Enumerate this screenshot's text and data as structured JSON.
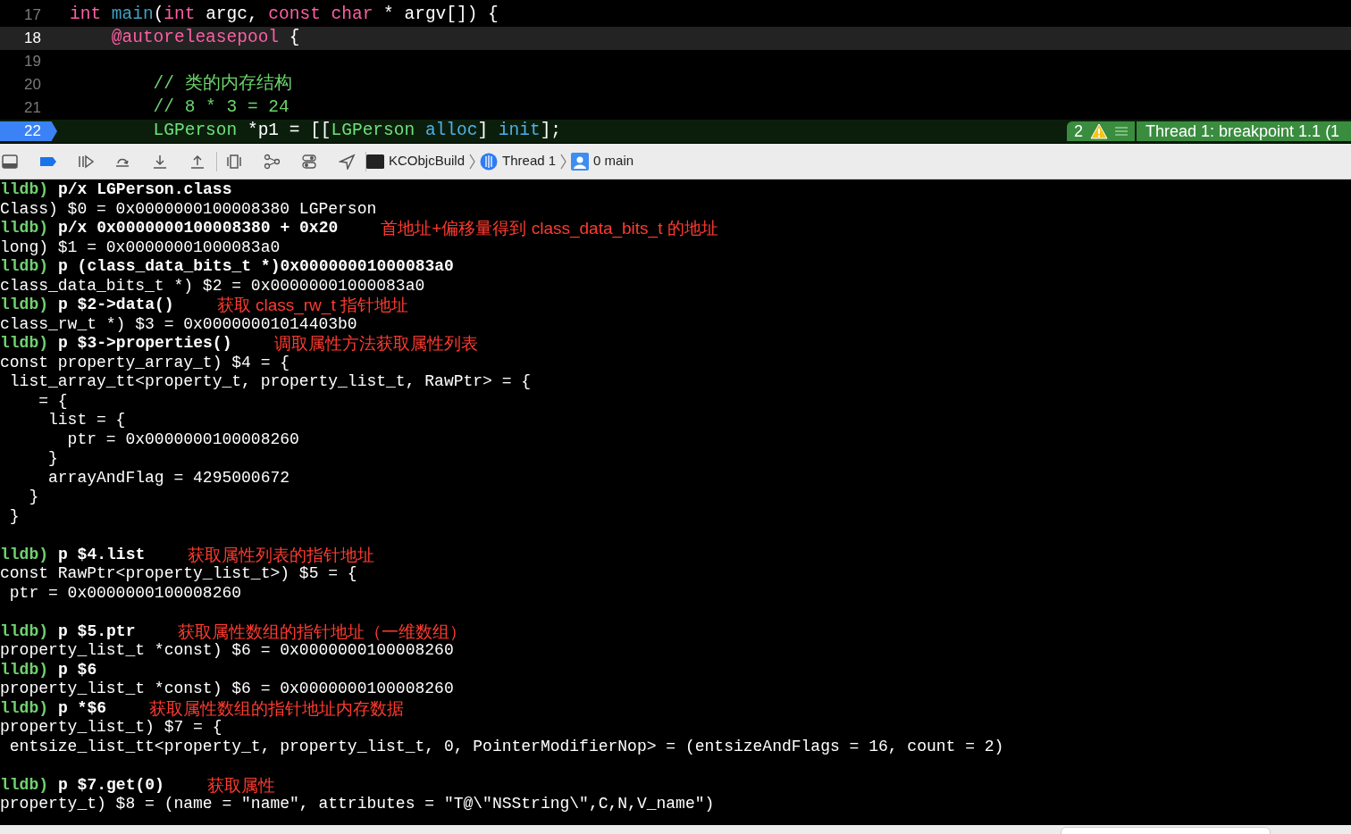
{
  "editor": {
    "lines": [
      {
        "number": "17",
        "highlighted": false,
        "breakpoint": false,
        "tokens": [
          {
            "kind": "keyword",
            "text": "int"
          },
          {
            "kind": "function",
            "text": " main"
          },
          {
            "kind": "plain",
            "text": "("
          },
          {
            "kind": "keyword",
            "text": "int"
          },
          {
            "kind": "plain",
            "text": " argc, "
          },
          {
            "kind": "keyword",
            "text": "const char"
          },
          {
            "kind": "plain",
            "text": " * argv[]) {"
          }
        ]
      },
      {
        "number": "18",
        "highlighted": true,
        "breakpoint": false,
        "tokens": [
          {
            "kind": "keyword",
            "text": "    @autoreleasepool"
          },
          {
            "kind": "plain",
            "text": " {"
          }
        ]
      },
      {
        "number": "19",
        "highlighted": false,
        "breakpoint": false
      },
      {
        "number": "20",
        "highlighted": false,
        "breakpoint": false,
        "tokens": [
          {
            "kind": "comment",
            "text": "        // 类的内存结构"
          }
        ]
      },
      {
        "number": "21",
        "highlighted": false,
        "breakpoint": false,
        "tokens": [
          {
            "kind": "comment",
            "text": "        // 8 * 3 = 24"
          }
        ]
      },
      {
        "number": "22",
        "highlighted": false,
        "breakpoint": true,
        "tokens": [
          {
            "kind": "type",
            "text": "        LGPerson"
          },
          {
            "kind": "plain",
            "text": " *p1 = [["
          },
          {
            "kind": "type",
            "text": "LGPerson"
          },
          {
            "kind": "method",
            "text": " alloc"
          },
          {
            "kind": "plain",
            "text": "] "
          },
          {
            "kind": "method",
            "text": "init"
          },
          {
            "kind": "plain",
            "text": "];"
          }
        ]
      }
    ],
    "badge": {
      "count": "2",
      "message": "Thread 1: breakpoint 1.1 (1"
    }
  },
  "debug_bar": {
    "breadcrumbs": [
      {
        "kind": "target",
        "label": "KCObjcBuild"
      },
      {
        "kind": "thread",
        "label": "Thread 1"
      },
      {
        "kind": "frame",
        "label": "0 main"
      }
    ]
  },
  "console": {
    "lines": [
      {
        "kind": "prompt",
        "prompt": "lldb)",
        "command": "p/x LGPerson.class"
      },
      {
        "kind": "output",
        "text": "Class) $0 = 0x0000000100008380 LGPerson"
      },
      {
        "kind": "prompt",
        "prompt": "lldb)",
        "command": "p/x 0x0000000100008380 + 0x20",
        "note": "首地址+偏移量得到 class_data_bits_t 的地址"
      },
      {
        "kind": "output",
        "text": "long) $1 = 0x00000001000083a0"
      },
      {
        "kind": "prompt",
        "prompt": "lldb)",
        "command": "p (class_data_bits_t *)0x00000001000083a0"
      },
      {
        "kind": "output",
        "text": "class_data_bits_t *) $2 = 0x00000001000083a0"
      },
      {
        "kind": "prompt",
        "prompt": "lldb)",
        "command": "p $2->data()",
        "note": "获取 class_rw_t 指针地址"
      },
      {
        "kind": "output",
        "text": "class_rw_t *) $3 = 0x00000001014403b0"
      },
      {
        "kind": "prompt",
        "prompt": "lldb)",
        "command": "p $3->properties()",
        "note": "调取属性方法获取属性列表"
      },
      {
        "kind": "output",
        "text": "const property_array_t) $4 = {"
      },
      {
        "kind": "output",
        "text": " list_array_tt<property_t, property_list_t, RawPtr> = {"
      },
      {
        "kind": "output",
        "text": "    = {"
      },
      {
        "kind": "output",
        "text": "     list = {"
      },
      {
        "kind": "output",
        "text": "       ptr = 0x0000000100008260"
      },
      {
        "kind": "output",
        "text": "     }"
      },
      {
        "kind": "output",
        "text": "     arrayAndFlag = 4295000672"
      },
      {
        "kind": "output",
        "text": "   }"
      },
      {
        "kind": "output",
        "text": " }"
      },
      {
        "kind": "blank"
      },
      {
        "kind": "prompt",
        "prompt": "lldb)",
        "command": "p $4.list",
        "note": "获取属性列表的指针地址"
      },
      {
        "kind": "output",
        "text": "const RawPtr<property_list_t>) $5 = {"
      },
      {
        "kind": "output",
        "text": " ptr = 0x0000000100008260"
      },
      {
        "kind": "blank"
      },
      {
        "kind": "prompt",
        "prompt": "lldb)",
        "command": "p $5.ptr",
        "note": "获取属性数组的指针地址（一维数组）"
      },
      {
        "kind": "output",
        "text": "property_list_t *const) $6 = 0x0000000100008260"
      },
      {
        "kind": "prompt",
        "prompt": "lldb)",
        "command": "p $6"
      },
      {
        "kind": "output",
        "text": "property_list_t *const) $6 = 0x0000000100008260"
      },
      {
        "kind": "prompt",
        "prompt": "lldb)",
        "command": "p *$6",
        "note": "获取属性数组的指针地址内存数据"
      },
      {
        "kind": "output",
        "text": "property_list_t) $7 = {"
      },
      {
        "kind": "output",
        "text": " entsize_list_tt<property_t, property_list_t, 0, PointerModifierNop> = (entsizeAndFlags = 16, count = 2)"
      },
      {
        "kind": "blank"
      },
      {
        "kind": "prompt",
        "prompt": "lldb)",
        "command": "p $7.get(0)",
        "note": "获取属性"
      },
      {
        "kind": "output",
        "text": "property_t) $8 = (name = \"name\", attributes = \"T@\\\"NSString\\\",C,N,V_name\")"
      }
    ]
  }
}
